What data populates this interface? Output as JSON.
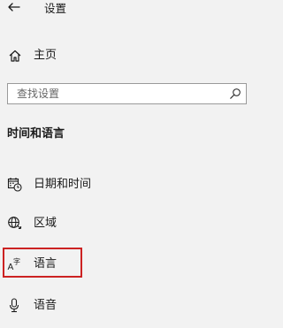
{
  "window": {
    "title": "设置"
  },
  "nav": {
    "home_label": "主页",
    "back_icon": "back-arrow-icon"
  },
  "search": {
    "placeholder": "查找设置",
    "value": ""
  },
  "section": {
    "title": "时间和语言"
  },
  "items": [
    {
      "label": "日期和时间",
      "icon": "calendar-clock-icon"
    },
    {
      "label": "区域",
      "icon": "globe-region-icon"
    },
    {
      "label": "语言",
      "icon": "language-icon",
      "highlighted": true
    },
    {
      "label": "语音",
      "icon": "microphone-icon"
    }
  ],
  "colors": {
    "background": "#f2f2f2",
    "highlight_border": "#cc2222",
    "search_border": "#9a9a9a"
  }
}
